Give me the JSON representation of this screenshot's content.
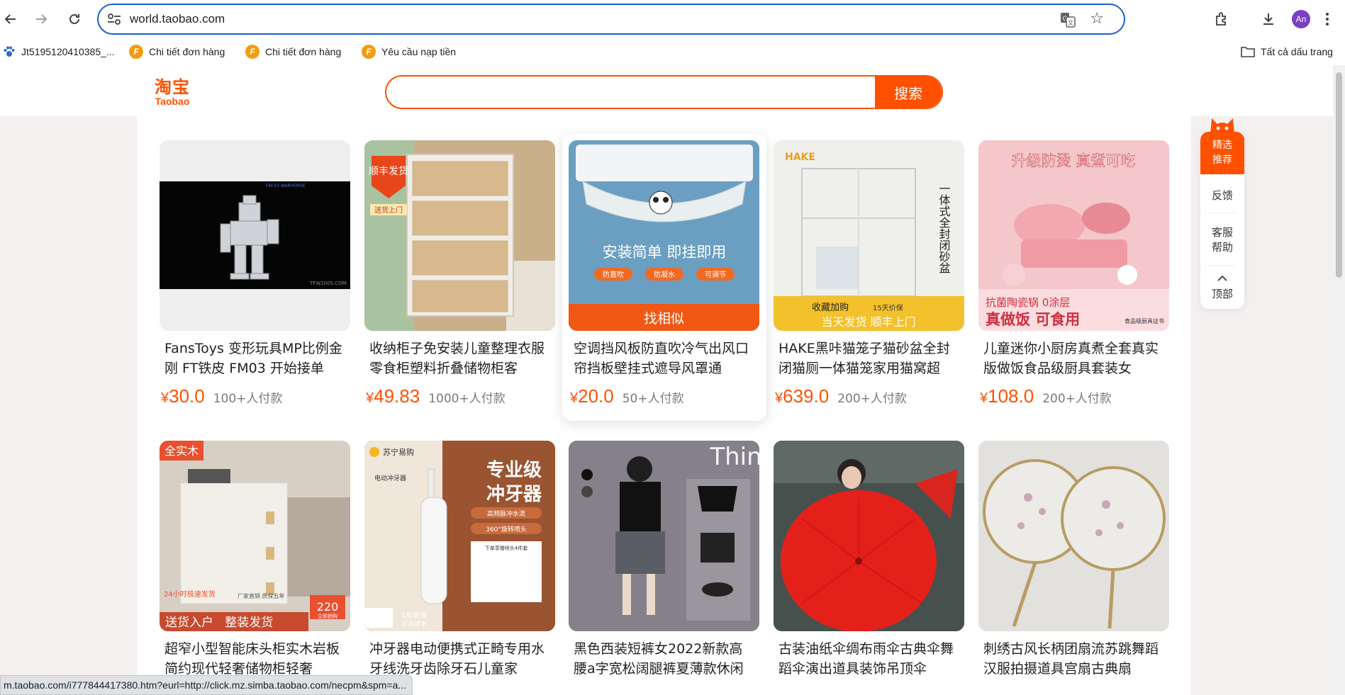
{
  "browser": {
    "url": "world.taobao.com",
    "bookmarks": [
      {
        "label": "Jt5195120410385_..."
      },
      {
        "label": "Chi tiết đơn hàng"
      },
      {
        "label": "Chi tiết đơn hàng"
      },
      {
        "label": "Yêu cầu nạp tiền"
      }
    ],
    "all_bookmarks_label": "Tất cả dấu trang",
    "avatar_initials": "An",
    "status_url": "m.taobao.com/i777844417380.htm?eurl=http://click.mz.simba.taobao.com/necpm&spm=a..."
  },
  "taobao": {
    "logo_cn": "淘宝",
    "logo_en": "Taobao",
    "search_placeholder": "",
    "search_button": "搜索",
    "find_similar": "找相似",
    "accent_color": "#ff5000"
  },
  "side_panel": {
    "recommend": "精选推荐",
    "feedback": "反馈",
    "help_line1": "客服",
    "help_line2": "帮助",
    "top_label": "顶部"
  },
  "products_row1": [
    {
      "title": "FansToys 变形玩具MP比例金刚 FT铁皮 FM03 开始接单",
      "currency": "¥",
      "price": "30.0",
      "sold": "100+人付款",
      "image_desc": "robot-figure"
    },
    {
      "title": "收纳柜子免安装儿童整理衣服零食柜塑料折叠储物柜客",
      "currency": "¥",
      "price": "49.83",
      "sold": "1000+人付款",
      "image_desc": "storage-cabinet",
      "badge": "顺丰发货",
      "badge_sub": "送货上门"
    },
    {
      "title": "空调挡风板防直吹冷气出风口帘挡板壁挂式遮导风罩通",
      "currency": "¥",
      "price": "20.0",
      "sold": "50+人付款",
      "image_desc": "ac-deflector",
      "overlay": "安装简单 即挂即用",
      "tags": [
        "防直吹",
        "防凝水",
        "可调节"
      ]
    },
    {
      "title": "HAKE黑咔猫笼子猫砂盆全封闭猫厕一体猫笼家用猫窝超",
      "currency": "¥",
      "price": "639.0",
      "sold": "200+人付款",
      "image_desc": "cat-cage",
      "brand": "HAKE",
      "vertical": "一体式全封闭砂盆",
      "banner_top": "收藏加购",
      "banner_top_small": "15天价保",
      "banner_bottom": "当天发货 顺丰上门"
    },
    {
      "title": "儿童迷你小厨房真煮全套真实版做饭食品级厨具套装女",
      "currency": "¥",
      "price": "108.0",
      "sold": "200+人付款",
      "image_desc": "mini-kitchen",
      "overlay_top": "升级防烫 真煮可吃",
      "overlay_bottom": "抗菌陶瓷锅 0涂层",
      "overlay_bottom2": "真做饭 可食用",
      "cert": "食品级厨具证书"
    }
  ],
  "products_row2": [
    {
      "title": "超窄小型智能床头柜实木岩板简约现代轻奢储物柜轻奢",
      "image_desc": "nightstand",
      "corner": "全实木",
      "banner": "送货入户   整装发货",
      "small_tag": "24小时极速发货",
      "small_tag2": "厂家直销 质保五年",
      "price_tag": "220",
      "price_tag_sub": "立即抢购"
    },
    {
      "title": "冲牙器电动便携式正畸专用水牙线洗牙齿除牙石儿童家",
      "image_desc": "water-flosser",
      "brand": "苏宁易购",
      "headline1": "专业级",
      "headline2": "冲牙器",
      "feature1": "高频脉冲水流",
      "feature2": "360°旋转喷头",
      "box_text": "电动冲牙器",
      "nozzle_text": "下单享赠喷头4件套",
      "warranty": "1年质保",
      "warranty_sub": "可发顺丰"
    },
    {
      "title": "黑色西装短裤女2022新款高腰a字宽松阔腿裤夏薄款休闲",
      "image_desc": "shorts-outfit",
      "overlay": "Thin"
    },
    {
      "title": "古装油纸伞绸布雨伞古典伞舞蹈伞演出道具装饰吊顶伞",
      "image_desc": "red-umbrella"
    },
    {
      "title": "刺绣古风长柄团扇流苏跳舞蹈汉服拍摄道具宫扇古典扇",
      "image_desc": "embroidered-fans"
    }
  ]
}
